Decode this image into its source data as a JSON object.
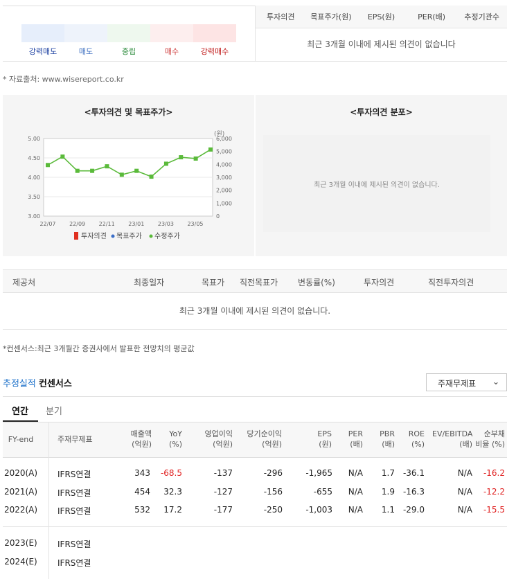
{
  "gauge": {
    "labels": [
      "강력매도",
      "매도",
      "중립",
      "매수",
      "강력매수"
    ],
    "label_colors": [
      "#1a3ea0",
      "#3b6dc0",
      "#2a8a3a",
      "#d04040",
      "#c01818"
    ],
    "fills": [
      "#e6eefb",
      "#eef3fb",
      "#eef8ee",
      "#fdeeee",
      "#fde4e4"
    ]
  },
  "opinion_table": {
    "headers": [
      "투자의견",
      "목표주가(원)",
      "EPS(원)",
      "PER(배)",
      "추정기관수"
    ],
    "empty_message": "최근 3개월 이내에 제시된 의견이 없습니다"
  },
  "source_note": "* 자료출처: www.wisereport.co.kr",
  "chart_panel": {
    "title": "<투자의견 및 목표주가>",
    "legend": [
      "투자의견",
      "목표주가",
      "수정주가"
    ],
    "unit_label": "(원)"
  },
  "chart_data": {
    "type": "line",
    "title": "<투자의견 및 목표주가>",
    "x_ticks": [
      "22/07",
      "22/09",
      "22/11",
      "23/01",
      "23/03",
      "23/05"
    ],
    "y_left_ticks": [
      "5.00",
      "4.50",
      "4.00",
      "3.50",
      "3.00"
    ],
    "y_left_range": [
      3.0,
      5.0
    ],
    "y_right_ticks": [
      "6,000",
      "5,000",
      "4,000",
      "3,000",
      "2,000",
      "1,000",
      "0"
    ],
    "y_right_range": [
      0,
      6000
    ],
    "series": [
      {
        "name": "수정주가",
        "color": "#5aba3a",
        "values": [
          3950,
          4600,
          3500,
          3500,
          3850,
          3200,
          3500,
          3050,
          4050,
          4550,
          4450,
          5150
        ]
      }
    ],
    "legend_colors": [
      "#e03020",
      "#3a6ec8",
      "#5aba3a"
    ]
  },
  "distribution_panel": {
    "title": "<투자의견 분포>",
    "empty_message": "최근 3개월 이내에 제시된 의견이 없습니다."
  },
  "report_table": {
    "headers": [
      "제공처",
      "최종일자",
      "목표가",
      "직전목표가",
      "변동률(%)",
      "투자의견",
      "직전투자의견"
    ],
    "empty_message": "최근 3개월 이내에 제시된 의견이 없습니다."
  },
  "consensus_note": "*컨센서스:최근 3개월간 증권사에서 발표한 전망치의 평균값",
  "estimate": {
    "title_blue": "추정실적",
    "title_bold": "컨센서스",
    "select_value": "주재무제표",
    "tabs": [
      "연간",
      "분기"
    ],
    "headers": [
      [
        "FY-end"
      ],
      [
        "주재무제표"
      ],
      [
        "매출액",
        "(억원)"
      ],
      [
        "YoY",
        "(%)"
      ],
      [
        "영업이익",
        "(억원)"
      ],
      [
        "당기순이익",
        "(억원)"
      ],
      [
        "EPS",
        "(원)"
      ],
      [
        "PER",
        "(배)"
      ],
      [
        "PBR",
        "(배)"
      ],
      [
        "ROE",
        "(%)"
      ],
      [
        "EV/EBITDA",
        "(배)"
      ],
      [
        "순부채",
        "비율 (%)"
      ]
    ],
    "rows": [
      {
        "fy": "2020(A)",
        "basis": "IFRS연결",
        "sales": "343",
        "yoy": "-68.5",
        "op": "-137",
        "net": "-296",
        "eps": "-1,965",
        "per": "N/A",
        "pbr": "1.7",
        "roe": "-36.1",
        "ev": "N/A",
        "debt": "-16.2"
      },
      {
        "fy": "2021(A)",
        "basis": "IFRS연결",
        "sales": "454",
        "yoy": "32.3",
        "op": "-127",
        "net": "-156",
        "eps": "-655",
        "per": "N/A",
        "pbr": "1.9",
        "roe": "-16.3",
        "ev": "N/A",
        "debt": "-12.2"
      },
      {
        "fy": "2022(A)",
        "basis": "IFRS연결",
        "sales": "532",
        "yoy": "17.2",
        "op": "-177",
        "net": "-250",
        "eps": "-1,003",
        "per": "N/A",
        "pbr": "1.1",
        "roe": "-29.0",
        "ev": "N/A",
        "debt": "-15.5"
      }
    ],
    "est_rows": [
      {
        "fy": "2023(E)",
        "basis": "IFRS연결"
      },
      {
        "fy": "2024(E)",
        "basis": "IFRS연결"
      }
    ]
  }
}
